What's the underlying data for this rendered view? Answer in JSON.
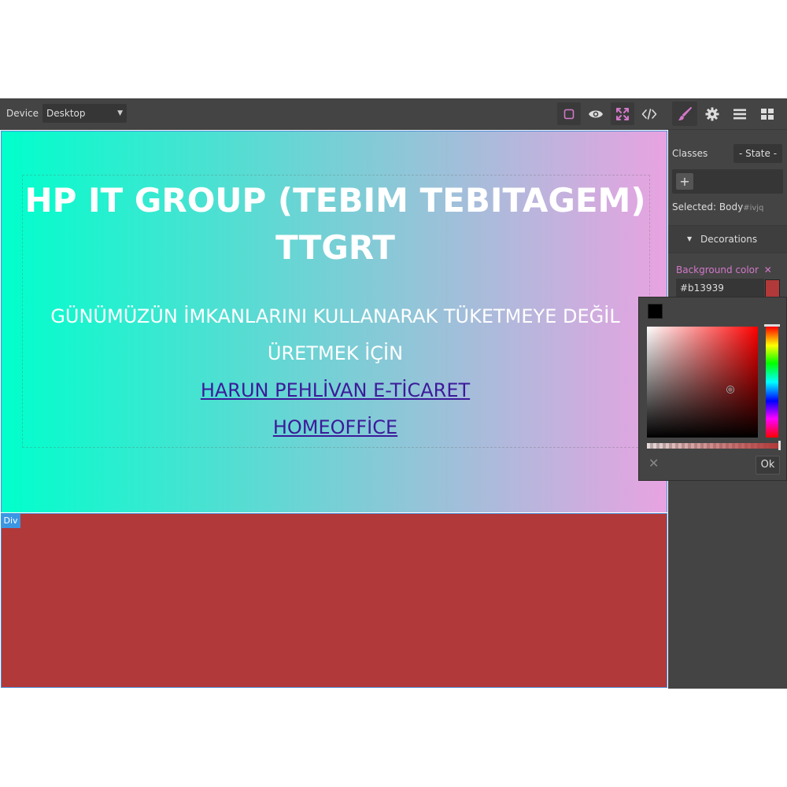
{
  "toolbar": {
    "device_label": "Device",
    "device_value": "Desktop",
    "buttons": [
      {
        "name": "sw-visibility",
        "icon": "square-outline-icon"
      },
      {
        "name": "preview",
        "icon": "eye-icon"
      },
      {
        "name": "fullscreen",
        "icon": "expand-icon"
      },
      {
        "name": "export-template",
        "icon": "code-icon"
      }
    ]
  },
  "panel_tabs": [
    {
      "name": "style-manager",
      "icon": "paint-brush-icon"
    },
    {
      "name": "settings",
      "icon": "gear-icon"
    },
    {
      "name": "layer-manager",
      "icon": "bars-icon"
    },
    {
      "name": "blocks",
      "icon": "grid-icon"
    }
  ],
  "canvas": {
    "title": "HP IT GROUP (TEBIM TEBITAGEM) TTGRT",
    "subtitle": "GÜNÜMÜZÜN İMKANLARINI KULLANARAK TÜKETMEYE DEĞİL ÜRETMEK İÇİN",
    "link1": "HARUN PEHLİVAN E-TİCARET",
    "link2": "HOMEOFFİCE",
    "selected_badge": "Div",
    "div_color": "#b13939"
  },
  "style_manager": {
    "classes_label": "Classes",
    "state_value": "- State -",
    "add_label": "+",
    "selected_label": "Selected:",
    "selected_name": "Body",
    "selected_id": "#ivjq",
    "sector": "Decorations",
    "bg_label": "Background color",
    "bg_value": "#b13939"
  },
  "picker": {
    "ok_label": "Ok",
    "cancel_icon": "close-icon",
    "hue_color": "#ff0000",
    "accent": "#d278c9"
  }
}
